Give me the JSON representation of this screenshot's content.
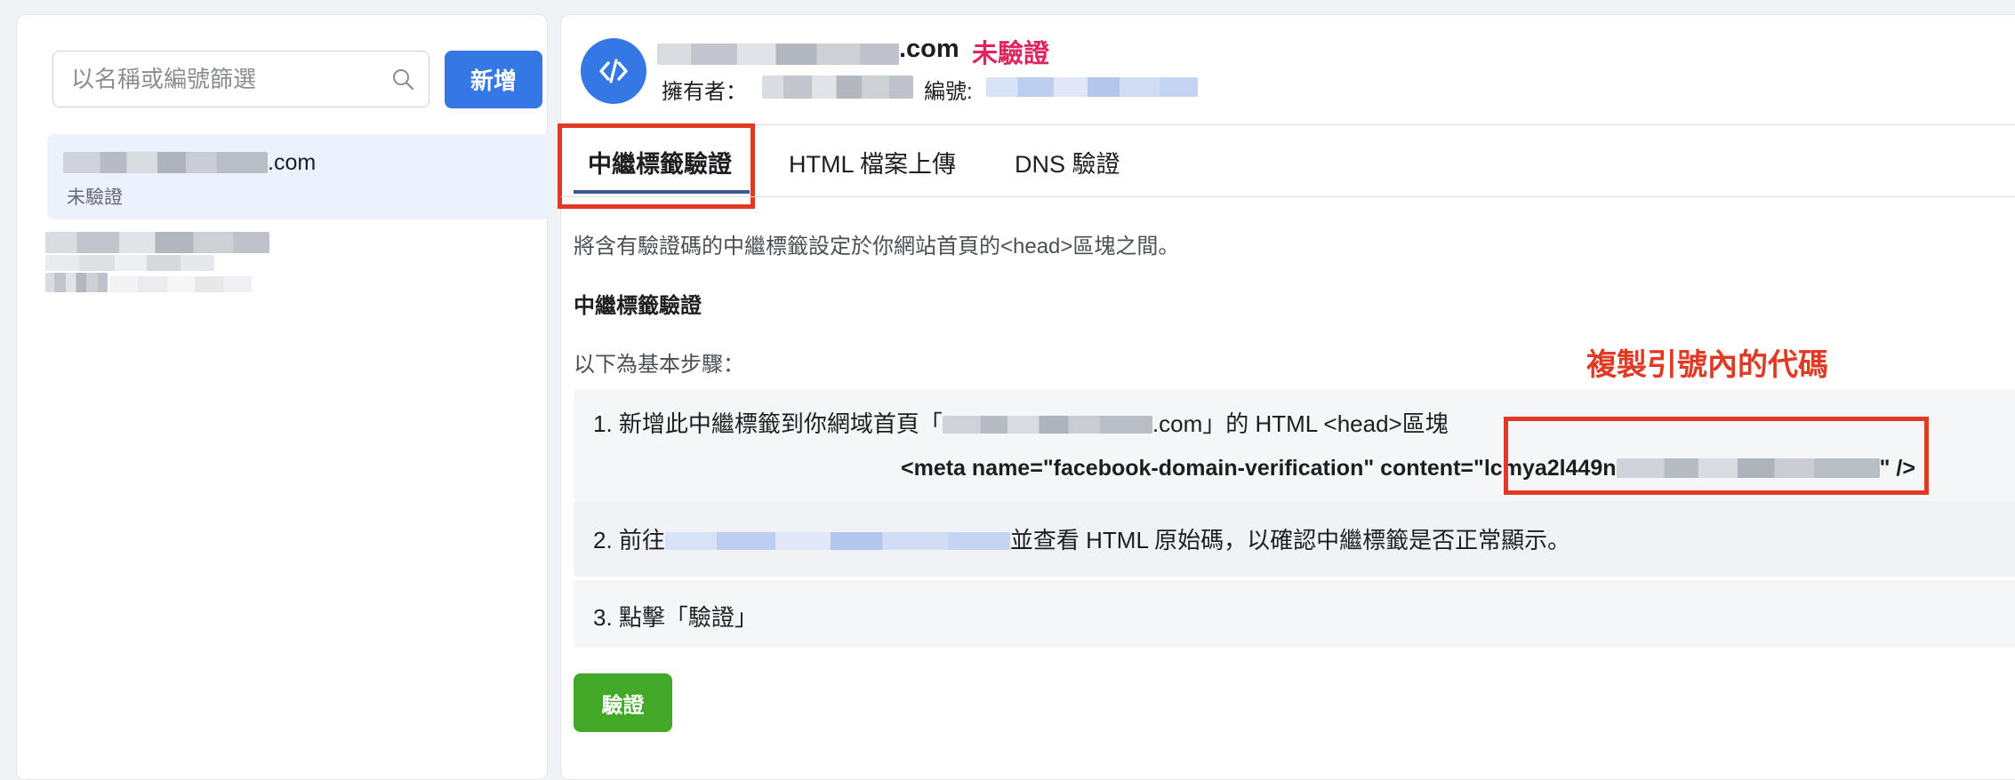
{
  "sidebar": {
    "search_placeholder": "以名稱或編號篩選",
    "add_label": "新增",
    "items": [
      {
        "domain": ".com",
        "status": "未驗證"
      }
    ]
  },
  "header": {
    "domain": ".com",
    "status": "未驗證",
    "owner_label": "擁有者：",
    "id_label": "編號:"
  },
  "tabs": [
    {
      "label": "中繼標籤驗證",
      "active": true
    },
    {
      "label": "HTML 檔案上傳"
    },
    {
      "label": "DNS 驗證"
    }
  ],
  "content": {
    "description": "將含有驗證碼的中繼標籤設定於你網站首頁的<head>區塊之間。",
    "section_title": "中繼標籤驗證",
    "steps_intro": "以下為基本步驟：",
    "annotation": "複製引號內的代碼",
    "step1_prefix": "1. 新增此中繼標籤到你網域首頁「",
    "step1_domain_suffix": ".com」的 HTML <head>區塊",
    "meta_code_prefix": "<meta name=\"facebook-domain-verification\" content=\"lcmya2l449n",
    "meta_code_suffix": "\" />",
    "step2_prefix": "2. 前往",
    "step2_suffix": "並查看 HTML 原始碼，以確認中繼標籤是否正常顯示。",
    "step3": "3. 點擊「驗證」",
    "verify_label": "驗證"
  },
  "colors": {
    "accent": "#3578e5",
    "unverified": "#e0245e",
    "highlight_annotation": "#e03a24",
    "verify_button": "#42a827"
  }
}
